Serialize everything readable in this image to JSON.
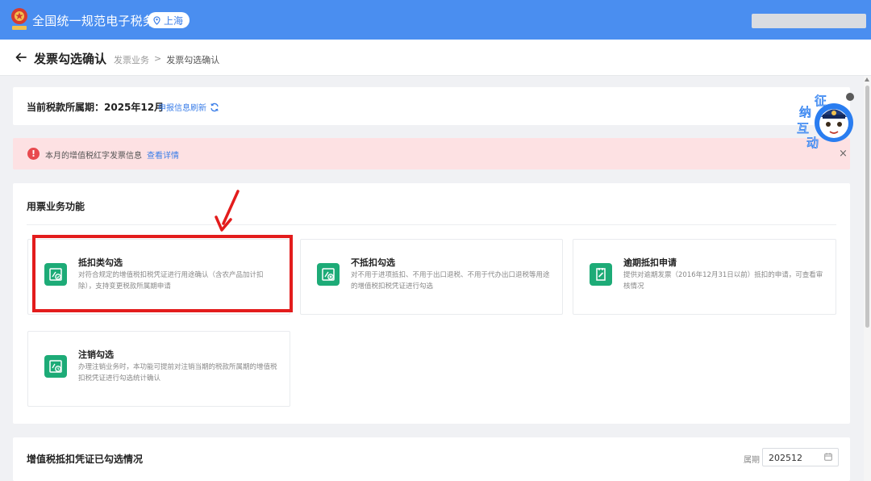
{
  "header": {
    "brand": "全国统一规范电子税务局",
    "location": "上海"
  },
  "titlebar": {
    "title": "发票勾选确认",
    "breadcrumb": [
      "发票业务",
      "发票勾选确认"
    ],
    "separator": ">"
  },
  "period": {
    "label": "当前税款所属期：2025年12月",
    "refresh_label": "申报信息刷新"
  },
  "alert": {
    "text": "本月的增值税红字发票信息",
    "link": "查看详情",
    "icon": "!",
    "close": "×"
  },
  "functions": {
    "title": "用票业务功能",
    "cards": [
      {
        "title": "抵扣类勾选",
        "desc": "对符合规定的增值税扣税凭证进行用途确认（含农产品加计扣除），支持变更税款所属期申请",
        "icon": "deduct-check-icon"
      },
      {
        "title": "不抵扣勾选",
        "desc": "对不用于进项抵扣、不用于出口退税、不用于代办出口退税等用途的增值税扣税凭证进行勾选",
        "icon": "no-deduct-icon"
      },
      {
        "title": "逾期抵扣申请",
        "desc": "提供对逾期发票（2016年12月31日以前）抵扣的申请，可查看审核情况",
        "icon": "overdue-apply-icon"
      },
      {
        "title": "注销勾选",
        "desc": "办理注销业务时，本功能可提前对注销当期的税款所属期的增值税扣税凭证进行勾选统计确认",
        "icon": "cancel-check-icon"
      }
    ]
  },
  "mascot": {
    "chars": [
      "征",
      "纳",
      "互",
      "动"
    ]
  },
  "selected_section": {
    "title": "增值税抵扣凭证已勾选情况",
    "period_label": "属期",
    "period_value": "202512"
  },
  "colors": {
    "header_blue": "#4a8ef0",
    "accent_blue": "#3b7ee8",
    "card_green": "#1dab77",
    "highlight_red": "#e31c1c",
    "alert_bg": "#fde1e3"
  }
}
